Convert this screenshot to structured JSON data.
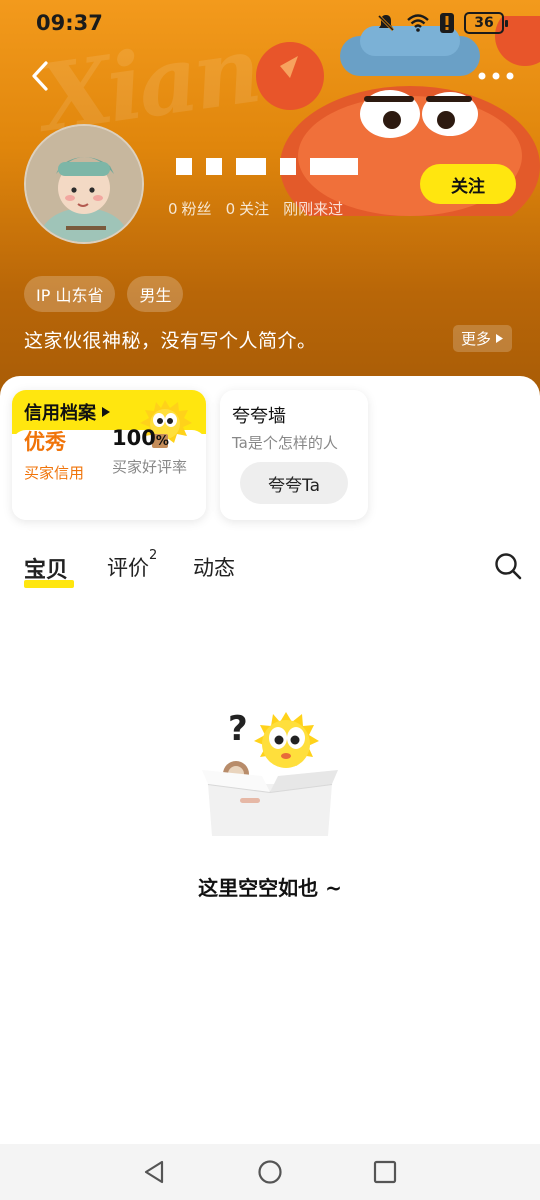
{
  "status_bar": {
    "time": "09:37",
    "battery": "36",
    "icons": [
      "mute-icon",
      "wifi-icon",
      "alert-icon",
      "battery-icon"
    ]
  },
  "header": {
    "back_icon": "chevron-left-icon",
    "more_icon": "more-dots-icon",
    "stats": {
      "fans_count": "0",
      "fans_label": "粉丝",
      "following_count": "0",
      "following_label": "关注",
      "last_seen": "刚刚来过"
    },
    "follow_button": "关注",
    "tags": [
      "IP 山东省",
      "男生"
    ],
    "bio": "这家伙很神秘，没有写个人简介。",
    "more_label": "更多"
  },
  "credit_card": {
    "title": "信用档案",
    "rating_value": "优秀",
    "rating_label": "买家信用",
    "praise_value": "100",
    "praise_unit": "%",
    "praise_label": "买家好评率"
  },
  "praise_wall": {
    "title": "夸夸墙",
    "subtitle": "Ta是个怎样的人",
    "button": "夸夸Ta"
  },
  "tabs": {
    "items": [
      "宝贝",
      "评价",
      "动态"
    ],
    "review_count": "2",
    "active": "宝贝",
    "search_icon": "search-icon"
  },
  "empty_state": {
    "message": "这里空空如也 ~"
  },
  "navbar": {
    "icons": [
      "back-triangle-icon",
      "home-circle-icon",
      "recents-square-icon"
    ]
  },
  "colors": {
    "accent_yellow": "#ffe60f",
    "header_orange": "#e0860c",
    "credit_orange": "#f0740a"
  }
}
